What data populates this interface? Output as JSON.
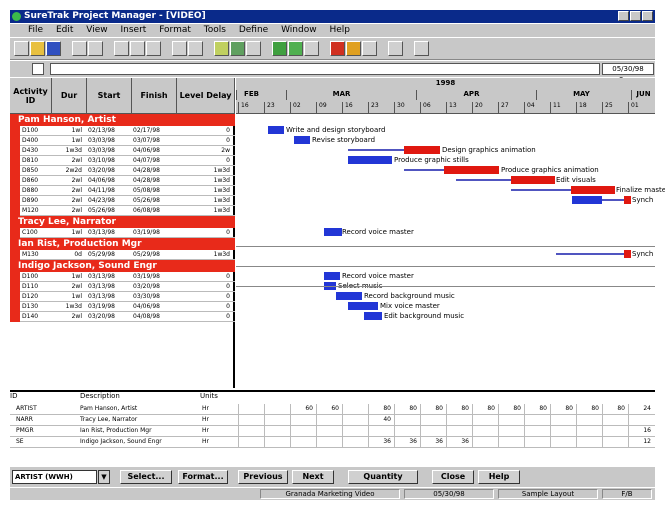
{
  "window": {
    "title": "SureTrak Project Manager - [VIDEO]"
  },
  "menu": [
    "File",
    "Edit",
    "View",
    "Insert",
    "Format",
    "Tools",
    "Define",
    "Window",
    "Help"
  ],
  "date_display": "05/30/98 3:am",
  "columns": {
    "activity_id": "Activity ID",
    "dur": "Dur",
    "start": "Start",
    "finish": "Finish",
    "level": "Level Delay"
  },
  "timeline": {
    "year": "1998",
    "months": [
      "FEB",
      "MAR",
      "APR",
      "MAY",
      "JUN"
    ],
    "weeks": [
      "16",
      "23",
      "02",
      "09",
      "16",
      "23",
      "30",
      "06",
      "13",
      "20",
      "27",
      "04",
      "11",
      "18",
      "25",
      "01"
    ]
  },
  "groups": [
    {
      "name": "Pam Hanson, Artist",
      "rows": [
        {
          "id": "D100",
          "dur": "1wl",
          "start": "02/13/98",
          "finish": "02/17/98",
          "delay": "0"
        },
        {
          "id": "D400",
          "dur": "1wl",
          "start": "03/03/98",
          "finish": "03/07/98",
          "delay": "0"
        },
        {
          "id": "D430",
          "dur": "1w3d",
          "start": "03/03/98",
          "finish": "04/06/98",
          "delay": "2w"
        },
        {
          "id": "D810",
          "dur": "2wl",
          "start": "03/10/98",
          "finish": "04/07/98",
          "delay": "0"
        },
        {
          "id": "D850",
          "dur": "2w2d",
          "start": "03/20/98",
          "finish": "04/28/98",
          "delay": "1w3d"
        },
        {
          "id": "D860",
          "dur": "2wl",
          "start": "04/06/98",
          "finish": "04/28/98",
          "delay": "1w3d"
        },
        {
          "id": "D880",
          "dur": "2wl",
          "start": "04/11/98",
          "finish": "05/08/98",
          "delay": "1w3d"
        },
        {
          "id": "D890",
          "dur": "2wl",
          "start": "04/23/98",
          "finish": "05/26/98",
          "delay": "1w3d"
        },
        {
          "id": "M120",
          "dur": "2wl",
          "start": "05/26/98",
          "finish": "06/08/98",
          "delay": "1w3d"
        }
      ]
    },
    {
      "name": "Tracy Lee, Narrator",
      "rows": [
        {
          "id": "C100",
          "dur": "1wl",
          "start": "03/13/98",
          "finish": "03/19/98",
          "delay": "0"
        }
      ]
    },
    {
      "name": "Ian Rist, Production Mgr",
      "rows": [
        {
          "id": "M130",
          "dur": "0d",
          "start": "05/29/98",
          "finish": "05/29/98",
          "delay": "1w3d"
        }
      ]
    },
    {
      "name": "Indigo Jackson, Sound Engr",
      "rows": [
        {
          "id": "D100",
          "dur": "1wl",
          "start": "03/13/98",
          "finish": "03/19/98",
          "delay": "0"
        },
        {
          "id": "D110",
          "dur": "2wl",
          "start": "03/13/98",
          "finish": "03/20/98",
          "delay": "0"
        },
        {
          "id": "D120",
          "dur": "1wl",
          "start": "03/13/98",
          "finish": "03/30/98",
          "delay": "0"
        },
        {
          "id": "D130",
          "dur": "1w3d",
          "start": "03/19/98",
          "finish": "04/06/98",
          "delay": "0"
        },
        {
          "id": "D140",
          "dur": "2wl",
          "start": "03/20/98",
          "finish": "04/08/98",
          "delay": "0"
        }
      ]
    }
  ],
  "gantt_labels": [
    "Write and design storyboard",
    "Revise storyboard",
    "Design graphics animation",
    "Produce graphic stills",
    "Produce graphics animation",
    "Edit visuals",
    "Finalize master",
    "Synch",
    "Record voice master",
    "Synch",
    "Record voice master",
    "Select music",
    "Record background music",
    "Mix voice master",
    "Edit background music"
  ],
  "resources": {
    "headers": {
      "id": "ID",
      "desc": "Description",
      "units": "Units"
    },
    "rows": [
      {
        "id": "ARTIST",
        "desc": "Pam Hanson, Artist",
        "units": "Hr",
        "values": [
          "",
          "",
          "60",
          "60",
          "",
          "80",
          "80",
          "80",
          "80",
          "80",
          "80",
          "80",
          "80",
          "80",
          "80",
          "24"
        ]
      },
      {
        "id": "NARR",
        "desc": "Tracy Lee, Narrator",
        "units": "Hr",
        "values": [
          "",
          "",
          "",
          "",
          "",
          "40",
          "",
          "",
          "",
          "",
          "",
          "",
          "",
          "",
          "",
          ""
        ]
      },
      {
        "id": "PMGR",
        "desc": "Ian Rist, Production Mgr",
        "units": "Hr",
        "values": [
          "",
          "",
          "",
          "",
          "",
          "",
          "",
          "",
          "",
          "",
          "",
          "",
          "",
          "",
          "",
          "16"
        ]
      },
      {
        "id": "SE",
        "desc": "Indigo Jackson, Sound Engr",
        "units": "Hr",
        "values": [
          "",
          "",
          "",
          "",
          "",
          "36",
          "36",
          "36",
          "36",
          "",
          "",
          "",
          "",
          "",
          "",
          "12"
        ]
      }
    ]
  },
  "buttons": {
    "select_value": "ARTIST (WWH)",
    "select": "Select...",
    "format": "Format...",
    "previous": "Previous",
    "next": "Next",
    "quantity": "Quantity",
    "close": "Close",
    "help": "Help"
  },
  "status": {
    "project": "Granada Marketing Video",
    "date": "05/30/98",
    "layout": "Sample Layout",
    "page": "F/B"
  }
}
